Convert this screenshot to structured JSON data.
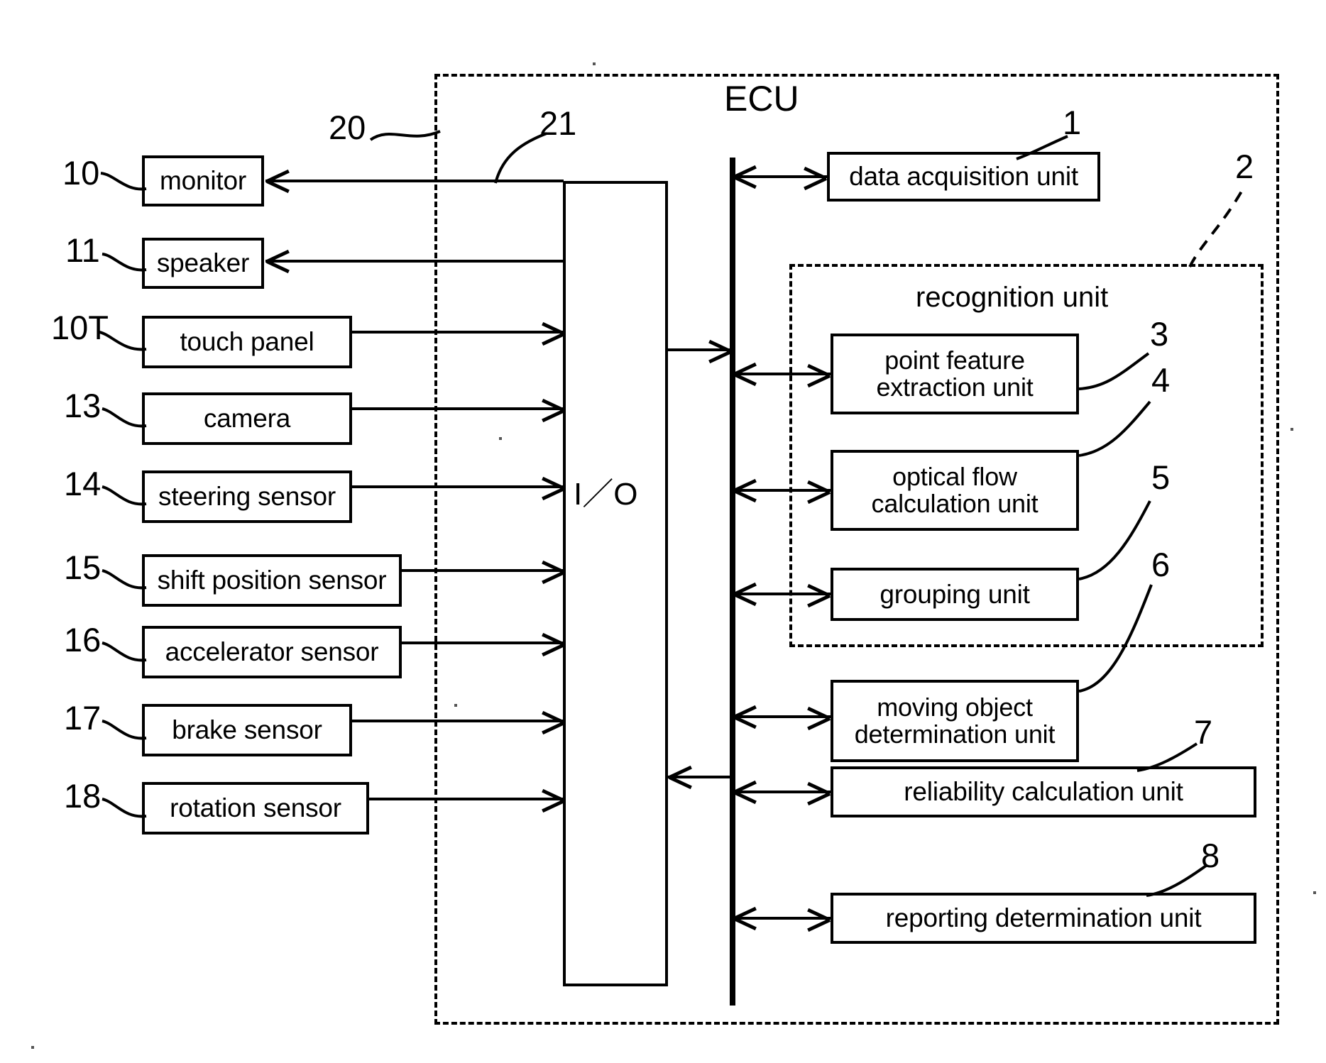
{
  "figure": {
    "type": "block-diagram",
    "ecu_title": "ECU",
    "recognition_title": "recognition unit",
    "io_label": "I／O",
    "ecu_ref": "20",
    "io_ref": "21"
  },
  "peripherals": [
    {
      "ref": "10",
      "label": "monitor",
      "direction": "out"
    },
    {
      "ref": "11",
      "label": "speaker",
      "direction": "out"
    },
    {
      "ref": "10T",
      "label": "touch panel",
      "direction": "in"
    },
    {
      "ref": "13",
      "label": "camera",
      "direction": "in"
    },
    {
      "ref": "14",
      "label": "steering sensor",
      "direction": "in"
    },
    {
      "ref": "15",
      "label": "shift position sensor",
      "direction": "in"
    },
    {
      "ref": "16",
      "label": "accelerator sensor",
      "direction": "in"
    },
    {
      "ref": "17",
      "label": "brake sensor",
      "direction": "in"
    },
    {
      "ref": "18",
      "label": "rotation sensor",
      "direction": "in"
    }
  ],
  "ecu_units": [
    {
      "ref": "1",
      "label": "data acquisition unit",
      "lines": [
        "data acquisition unit"
      ]
    },
    {
      "ref": "3",
      "label": "point feature extraction unit",
      "lines": [
        "point feature",
        "extraction unit"
      ]
    },
    {
      "ref": "4",
      "label": "optical flow calculation unit",
      "lines": [
        "optical flow",
        "calculation unit"
      ]
    },
    {
      "ref": "5",
      "label": "grouping unit",
      "lines": [
        "grouping unit"
      ]
    },
    {
      "ref": "6",
      "label": "moving object determination unit",
      "lines": [
        "moving object",
        "determination unit"
      ]
    },
    {
      "ref": "7",
      "label": "reliability calculation unit",
      "lines": [
        "reliability calculation unit"
      ]
    },
    {
      "ref": "8",
      "label": "reporting determination unit",
      "lines": [
        "reporting determination unit"
      ]
    }
  ],
  "recognition_group": {
    "ref": "2",
    "members": [
      "3",
      "4",
      "5",
      "6"
    ]
  },
  "labels": {
    "p0_ref": "10",
    "p0_label": "monitor",
    "p1_ref": "11",
    "p1_label": "speaker",
    "p2_ref": "10T",
    "p2_label": "touch panel",
    "p3_ref": "13",
    "p3_label": "camera",
    "p4_ref": "14",
    "p4_label": "steering sensor",
    "p5_ref": "15",
    "p5_label": "shift position sensor",
    "p6_ref": "16",
    "p6_label": "accelerator sensor",
    "p7_ref": "17",
    "p7_label": "brake sensor",
    "p8_ref": "18",
    "p8_label": "rotation sensor",
    "u0_ref": "1",
    "u0_l1": "data acquisition unit",
    "u1_ref": "3",
    "u1_l1": "point feature",
    "u1_l2": "extraction unit",
    "u2_ref": "4",
    "u2_l1": "optical flow",
    "u2_l2": "calculation unit",
    "u3_ref": "5",
    "u3_l1": "grouping unit",
    "u4_ref": "6",
    "u4_l1": "moving object",
    "u4_l2": "determination unit",
    "u5_ref": "7",
    "u5_l1": "reliability calculation unit",
    "u6_ref": "8",
    "u6_l1": "reporting determination unit",
    "group_ref": "2",
    "ecu_ref": "20",
    "io_ref": "21",
    "ecu_title": "ECU",
    "recognition_title": "recognition unit",
    "io_label": "I／O"
  },
  "colors": {
    "ink": "#000000",
    "paper": "#ffffff"
  }
}
